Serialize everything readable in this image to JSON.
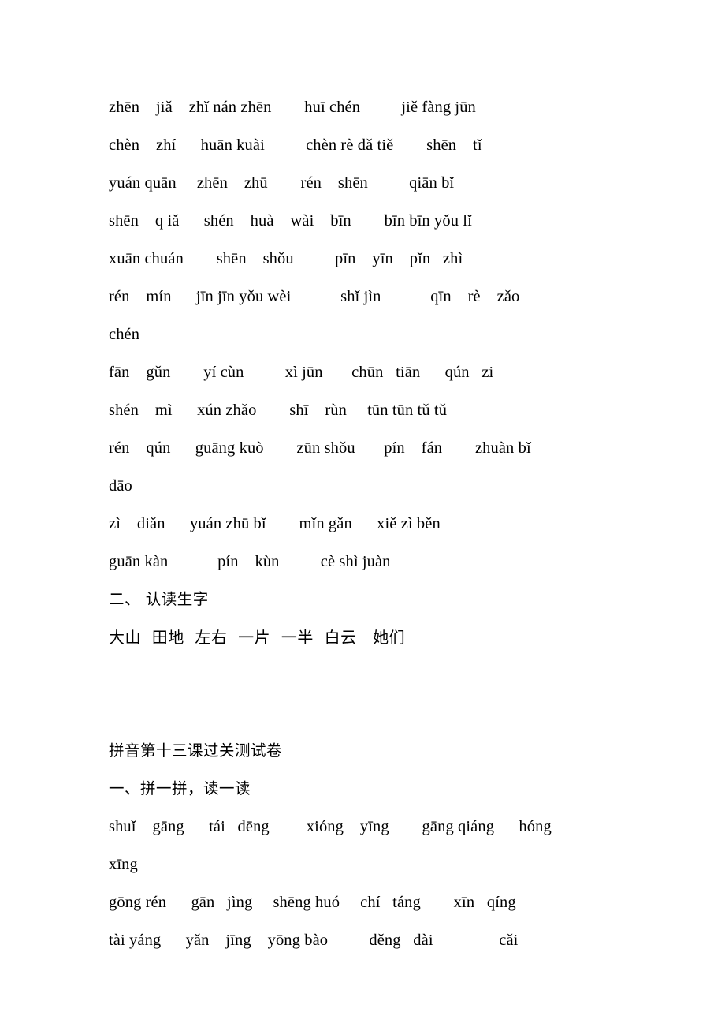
{
  "document": {
    "title_visible": "拼音第十三课过关测试卷",
    "page_background": "#ffffff",
    "text_color": "#000000"
  },
  "section_one": {
    "lines": [
      {
        "id": "l1",
        "text": "zhēn    jiǎ    zhǐ nán zhēn        huī chén          jiě fàng jūn",
        "script": "pinyin"
      },
      {
        "id": "l2",
        "text": "chèn    zhí      huān kuài          chèn rè dǎ tiě        shēn    tǐ",
        "script": "pinyin"
      },
      {
        "id": "l3",
        "text": "yuán quān     zhēn    zhū        rén    shēn          qiān bǐ",
        "script": "pinyin"
      },
      {
        "id": "l4",
        "text": "shēn    q iǎ      shén    huà    wài    bīn        bīn bīn yǒu lǐ",
        "script": "pinyin"
      },
      {
        "id": "l5",
        "text": "xuān chuán        shēn    shǒu          pīn    yīn    pǐn   zhì",
        "script": "pinyin"
      },
      {
        "id": "l6",
        "text": "rén    mín      jīn jīn yǒu wèi            shǐ jìn            qīn    rè    zǎo",
        "script": "pinyin"
      },
      {
        "id": "l7",
        "text": "chén",
        "script": "pinyin"
      },
      {
        "id": "l8",
        "text": "fān    gǔn        yí cùn          xì jūn       chūn   tiān      qún   zi",
        "script": "pinyin"
      },
      {
        "id": "l9",
        "text": "shén    mì      xún zhǎo        shī    rùn     tūn tūn tǔ tǔ",
        "script": "pinyin"
      },
      {
        "id": "l10",
        "text": "rén    qún      guāng kuò        zūn shǒu       pín    fán        zhuàn bǐ",
        "script": "pinyin"
      },
      {
        "id": "l11",
        "text": "dāo",
        "script": "pinyin"
      },
      {
        "id": "l12",
        "text": "zì    diǎn      yuán zhū bǐ        mǐn gǎn      xiě zì běn",
        "script": "pinyin"
      },
      {
        "id": "l13",
        "text": "guān kàn            pín    kùn          cè shì juàn",
        "script": "pinyin"
      },
      {
        "id": "l14",
        "text": "二、 认读生字",
        "script": "han-head"
      },
      {
        "id": "l15",
        "text": "大山  田地  左右  一片  一半  白云   她们",
        "script": "han"
      }
    ]
  },
  "spacer": {
    "blank_lines": 2
  },
  "section_two": {
    "lines": [
      {
        "id": "m1",
        "text": "拼音第十三课过关测试卷",
        "script": "han-head"
      },
      {
        "id": "m2",
        "text": "一、拼一拼，读一读",
        "script": "han-head"
      },
      {
        "id": "m3",
        "text": "shuǐ    gāng      tái   dēng         xióng    yīng        gāng qiáng      hóng",
        "script": "pinyin"
      },
      {
        "id": "m4",
        "text": "xīng",
        "script": "pinyin"
      },
      {
        "id": "m5",
        "text": "gōng rén      gān   jìng     shēng huó     chí   táng        xīn   qíng",
        "script": "pinyin"
      },
      {
        "id": "m6",
        "text": "tài yáng      yǎn    jīng    yōng bào          děng   dài                cǎi",
        "script": "pinyin"
      }
    ]
  }
}
